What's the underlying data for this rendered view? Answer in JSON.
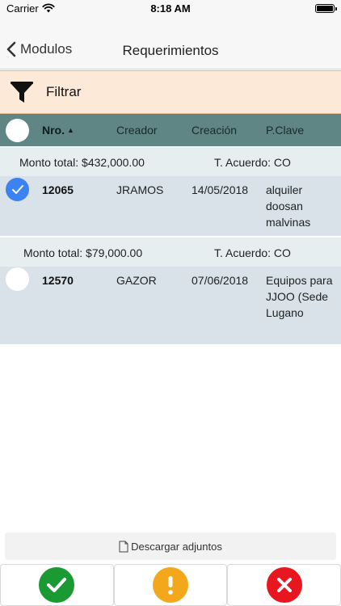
{
  "status_bar": {
    "carrier": "Carrier",
    "time": "8:18 AM"
  },
  "nav": {
    "back_label": "Modulos",
    "title": "Requerimientos"
  },
  "filter": {
    "label": "Filtrar",
    "icon": "funnel-icon"
  },
  "table_header": {
    "columns": [
      {
        "label": "Nro.",
        "sorted": "ascending"
      },
      {
        "label": "Creador"
      },
      {
        "label": "Creación"
      },
      {
        "label": "P.Clave"
      }
    ]
  },
  "groups": [
    {
      "monto": "Monto total: $432,000.00",
      "acuerdo": "T. Acuerdo: CO",
      "row": {
        "nro": "12065",
        "creador": "JRAMOS",
        "fecha": "14/05/2018",
        "clave": "alquiler doosan malvinas",
        "checked": true
      }
    },
    {
      "monto": "Monto total: $79,000.00",
      "acuerdo": "T. Acuerdo: CO",
      "row": {
        "nro": "12570",
        "creador": "GAZOR",
        "fecha": "07/06/2018",
        "clave": "Equipos para JJOO (Sede Lugano",
        "checked": false
      }
    }
  ],
  "download": {
    "label": "Descargar adjuntos",
    "icon": "document-icon"
  },
  "actions": [
    {
      "name": "approve",
      "icon": "check-icon",
      "color": "#1b9a33"
    },
    {
      "name": "observe",
      "icon": "exclamation-icon",
      "color": "#f3a81b"
    },
    {
      "name": "reject",
      "icon": "x-icon",
      "color": "#e8171f"
    }
  ],
  "colors": {
    "nav_bg": "#f7f7f7",
    "filter_bg": "#fde9d7",
    "header_bg": "#5f8584",
    "group_bg": "#e6eef0",
    "row_bg": "#d8e2e8",
    "checkbox_checked": "#3b82f3"
  }
}
